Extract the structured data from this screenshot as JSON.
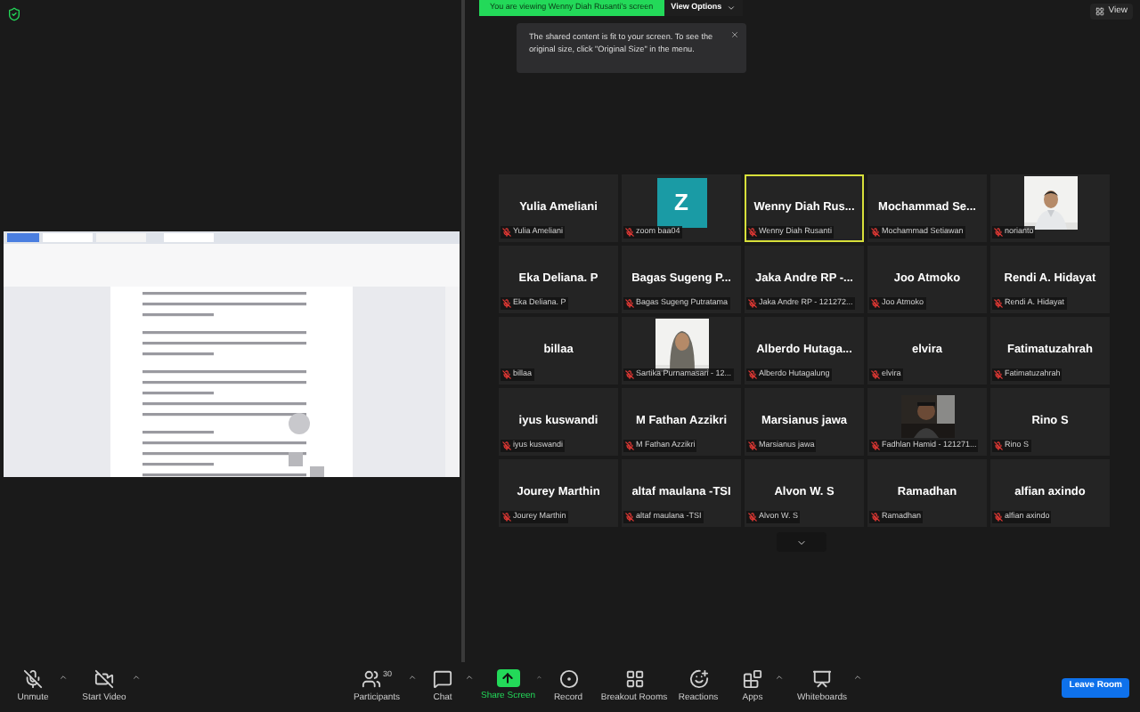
{
  "banner": {
    "text": "You are viewing Wenny Diah Rusanti's screen",
    "options": "View Options"
  },
  "tooltip": {
    "text": "The shared content is fit to your screen. To see the original size, click \"Original Size\" in the menu."
  },
  "view_button": "View",
  "tiles": [
    {
      "kind": "name",
      "title": "Yulia Ameliani",
      "label": "Yulia Ameliani",
      "speaking": false
    },
    {
      "kind": "avatar",
      "letter": "Z",
      "color": "#1a9ba5",
      "label": "zoom baa04",
      "speaking": false
    },
    {
      "kind": "name",
      "title": "Wenny Diah Rus...",
      "label": "Wenny Diah Rusanti",
      "speaking": true
    },
    {
      "kind": "name",
      "title": "Mochammad Se...",
      "label": "Mochammad Setiawan",
      "speaking": false
    },
    {
      "label": "norianto",
      "speaking": false
    },
    {
      "kind": "name",
      "title": "Eka Deliana. P",
      "label": "Eka Deliana. P",
      "speaking": false
    },
    {
      "kind": "name",
      "title": "Bagas Sugeng P...",
      "label": "Bagas Sugeng Putratama",
      "speaking": false
    },
    {
      "kind": "name",
      "title": "Jaka Andre RP -...",
      "label": "Jaka Andre RP - 121272...",
      "speaking": false
    },
    {
      "kind": "name",
      "title": "Joo Atmoko",
      "label": "Joo Atmoko",
      "speaking": false
    },
    {
      "kind": "name",
      "title": "Rendi A. Hidayat",
      "label": "Rendi A. Hidayat",
      "speaking": false
    },
    {
      "kind": "name",
      "title": "billaa",
      "label": "billaa",
      "speaking": false
    },
    {
      "label": "Sartika Purnamasari - 12...",
      "speaking": false
    },
    {
      "kind": "name",
      "title": "Alberdo Hutaga...",
      "label": "Alberdo Hutagalung",
      "speaking": false
    },
    {
      "kind": "name",
      "title": "elvira",
      "label": "elvira",
      "speaking": false
    },
    {
      "kind": "name",
      "title": "Fatimatuzahrah",
      "label": "Fatimatuzahrah",
      "speaking": false
    },
    {
      "kind": "name",
      "title": "iyus kuswandi",
      "label": "iyus kuswandi",
      "speaking": false
    },
    {
      "kind": "name",
      "title": "M Fathan Azzikri",
      "label": "M Fathan Azzikri",
      "speaking": false
    },
    {
      "kind": "name",
      "title": "Marsianus jawa",
      "label": "Marsianus jawa",
      "speaking": false
    },
    {
      "label": "Fadhlan Hamid - 121271...",
      "speaking": false
    },
    {
      "kind": "name",
      "title": "Rino S",
      "label": "Rino S",
      "speaking": false
    },
    {
      "kind": "name",
      "title": "Jourey Marthin",
      "label": "Jourey Marthin",
      "speaking": false
    },
    {
      "kind": "name",
      "title": "altaf maulana -TSI",
      "label": "altaf maulana -TSI",
      "speaking": false
    },
    {
      "kind": "name",
      "title": "Alvon W. S",
      "label": "Alvon W. S",
      "speaking": false
    },
    {
      "kind": "name",
      "title": "Ramadhan",
      "label": "Ramadhan",
      "speaking": false
    },
    {
      "kind": "name",
      "title": "alfian axindo",
      "label": "alfian axindo",
      "speaking": false
    }
  ],
  "toolbar": [
    {
      "kind": "mic",
      "label": "Unmute",
      "caret": true
    },
    {
      "kind": "video",
      "label": "Start Video",
      "caret": true
    },
    {
      "kind": "participants",
      "label": "Participants",
      "count": "30",
      "caret": true
    },
    {
      "kind": "chat",
      "label": "Chat",
      "caret": true
    },
    {
      "kind": "share",
      "label": "Share Screen",
      "caret": true
    },
    {
      "kind": "record",
      "label": "Record",
      "caret": false
    },
    {
      "kind": "breakout",
      "label": "Breakout Rooms",
      "caret": false
    },
    {
      "kind": "reactions",
      "label": "Reactions",
      "caret": false
    },
    {
      "kind": "apps",
      "label": "Apps",
      "caret": true
    },
    {
      "kind": "whiteboards",
      "label": "Whiteboards",
      "caret": true
    }
  ],
  "leave_button": "Leave Room"
}
